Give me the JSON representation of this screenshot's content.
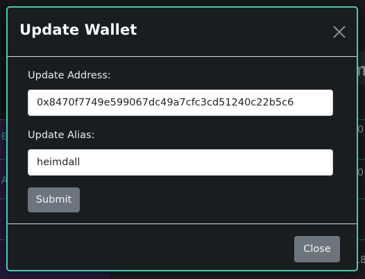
{
  "background": {
    "right_fragments": [
      "m",
      "0",
      "0",
      "4.8"
    ],
    "left_fragments": [
      "E",
      "AL"
    ]
  },
  "modal": {
    "title": "Update Wallet",
    "close_icon": "close-x-icon",
    "address_label": "Update Address:",
    "address_value": "0x8470f7749e599067dc49a7cfc3cd51240c22b5c6",
    "alias_label": "Update Alias:",
    "alias_value": "heimdall",
    "submit_label": "Submit",
    "close_label": "Close",
    "colors": {
      "border_accent": "#3fd1b0",
      "background": "#1a1d20",
      "button": "#6c757d"
    }
  }
}
